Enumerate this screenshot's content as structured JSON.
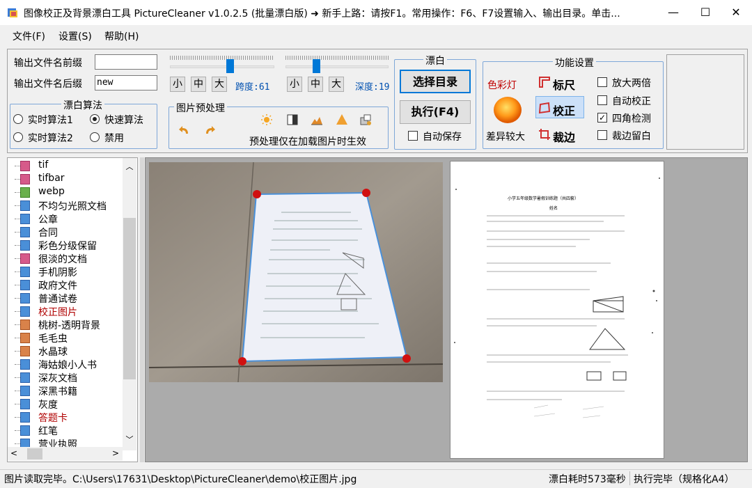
{
  "window": {
    "title": "图像校正及背景漂白工具 PictureCleaner v1.0.2.5  (批量漂白版)   ➜ 新手上路：请按F1。常用操作：F6、F7设置输入、输出目录。单击...",
    "minimize": "—",
    "maximize": "☐",
    "close": "✕"
  },
  "menu": [
    "文件(F)",
    "设置(S)",
    "帮助(H)"
  ],
  "output": {
    "prefix_label": "输出文件名前缀",
    "prefix_value": "",
    "suffix_label": "输出文件名后缀",
    "suffix_value": "new"
  },
  "bleach_algo": {
    "title": "漂白算法",
    "options": [
      "实时算法1",
      "快速算法",
      "实时算法2",
      "禁用"
    ],
    "selected": "快速算法"
  },
  "span": {
    "small": "小",
    "medium": "中",
    "large": "大",
    "label": "跨度:61",
    "value": 61
  },
  "depth": {
    "small": "小",
    "medium": "中",
    "large": "大",
    "label": "深度:19",
    "value": 19
  },
  "preprocess": {
    "title": "图片预处理",
    "note": "预处理仅在加载图片时生效"
  },
  "bleach": {
    "title": "漂白",
    "select_dir": "选择目录",
    "execute": "执行(F4)",
    "autosave": "自动保存",
    "autosave_checked": false
  },
  "features": {
    "title": "功能设置",
    "color_light": "色彩灯",
    "diff_large": "差异较大",
    "tool_mark": "标尺",
    "tool_correct": "校正",
    "tool_crop": "裁边",
    "checks": [
      {
        "label": "放大两倍",
        "checked": false
      },
      {
        "label": "自动校正",
        "checked": false
      },
      {
        "label": "四角检测",
        "checked": true
      },
      {
        "label": "裁边留白",
        "checked": false
      }
    ]
  },
  "file_list": [
    {
      "name": "tif",
      "type": "tif",
      "red": false
    },
    {
      "name": "tifbar",
      "type": "tif",
      "red": false
    },
    {
      "name": "webp",
      "type": "webp",
      "red": false
    },
    {
      "name": "不均匀光照文档",
      "type": "doc",
      "red": false
    },
    {
      "name": "公章",
      "type": "doc",
      "red": false
    },
    {
      "name": "合同",
      "type": "doc",
      "red": false
    },
    {
      "name": "彩色分级保留",
      "type": "doc",
      "red": false
    },
    {
      "name": "很淡的文档",
      "type": "tif",
      "red": false
    },
    {
      "name": "手机阴影",
      "type": "doc",
      "red": false
    },
    {
      "name": "政府文件",
      "type": "doc",
      "red": false
    },
    {
      "name": "普通试卷",
      "type": "doc",
      "red": false
    },
    {
      "name": "校正图片",
      "type": "doc",
      "red": true
    },
    {
      "name": "桃树-透明背景",
      "type": "red",
      "red": false
    },
    {
      "name": "毛毛虫",
      "type": "red",
      "red": false
    },
    {
      "name": "水晶球",
      "type": "red",
      "red": false
    },
    {
      "name": "海姑娘小人书",
      "type": "doc",
      "red": false
    },
    {
      "name": "深灰文档",
      "type": "doc",
      "red": false
    },
    {
      "name": "深黑书籍",
      "type": "doc",
      "red": false
    },
    {
      "name": "灰度",
      "type": "doc",
      "red": false
    },
    {
      "name": "答题卡",
      "type": "doc",
      "red": true
    },
    {
      "name": "红笔",
      "type": "doc",
      "red": false
    },
    {
      "name": "营业执照",
      "type": "doc",
      "red": false
    }
  ],
  "doc_preview": {
    "title": "小学五年级数学暑假训练题（共四套）",
    "subtitle": "姓名"
  },
  "status": {
    "left": "图片读取完毕。C:\\Users\\17631\\Desktop\\PictureCleaner\\demo\\校正图片.jpg",
    "time": "漂白耗时573毫秒",
    "result": "执行完毕（规格化A4）"
  }
}
